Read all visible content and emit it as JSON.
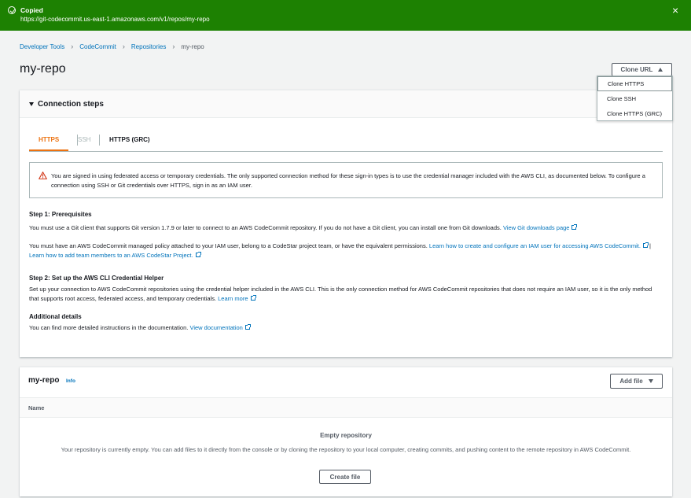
{
  "flash": {
    "title": "Copied",
    "message": "https://git-codecommit.us-east-1.amazonaws.com/v1/repos/my-repo",
    "close": "×"
  },
  "breadcrumb": [
    "Developer Tools",
    "CodeCommit",
    "Repositories",
    "my-repo"
  ],
  "page_title": "my-repo",
  "clone_button": "Clone URL",
  "clone_menu": [
    "Clone HTTPS",
    "Clone SSH",
    "Clone HTTPS (GRC)"
  ],
  "connection": {
    "title": "Connection steps",
    "tabs": [
      "HTTPS",
      "SSH",
      "HTTPS (GRC)"
    ],
    "alert": "You are signed in using federated access or temporary credentials. The only supported connection method for these sign-in types is to use the credential manager included with the AWS CLI, as documented below. To configure a connection using SSH or Git credentials over HTTPS, sign in as an IAM user.",
    "step1_title": "Step 1: Prerequisites",
    "step1_p1": "You must use a Git client that supports Git version 1.7.9 or later to connect to an AWS CodeCommit repository. If you do not have a Git client, you can install one from Git downloads.",
    "step1_p1_link": "View Git downloads page",
    "step1_p2": "You must have an AWS CodeCommit managed policy attached to your IAM user, belong to a CodeStar project team, or have the equivalent permissions.",
    "step1_p2_link1": "Learn how to create and configure an IAM user for accessing AWS CodeCommit.",
    "step1_p2_sep": "|",
    "step1_p2_link2": "Learn how to add team members to an AWS CodeStar Project.",
    "step2_title": "Step 2: Set up the AWS CLI Credential Helper",
    "step2_p": "Set up your connection to AWS CodeCommit repositories using the credential helper included in the AWS CLI. This is the only connection method for AWS CodeCommit repositories that does not require an IAM user, so it is the only method that supports root access, federated access, and temporary credentials.",
    "step2_link": "Learn more",
    "add_title": "Additional details",
    "add_p": "You can find more detailed instructions in the documentation.",
    "add_link": "View documentation"
  },
  "repo": {
    "title": "my-repo",
    "info": "Info",
    "add_file": "Add file",
    "name_col": "Name",
    "empty_title": "Empty repository",
    "empty_msg": "Your repository is currently empty. You can add files to it directly from the console or by cloning the repository to your local computer, creating commits, and pushing content to the remote repository in AWS CodeCommit.",
    "create_file": "Create file"
  },
  "colors": {
    "flash_green": "#1d8102",
    "link_blue": "#0073bb",
    "tab_orange": "#ec7211",
    "warning_red": "#d13212"
  }
}
